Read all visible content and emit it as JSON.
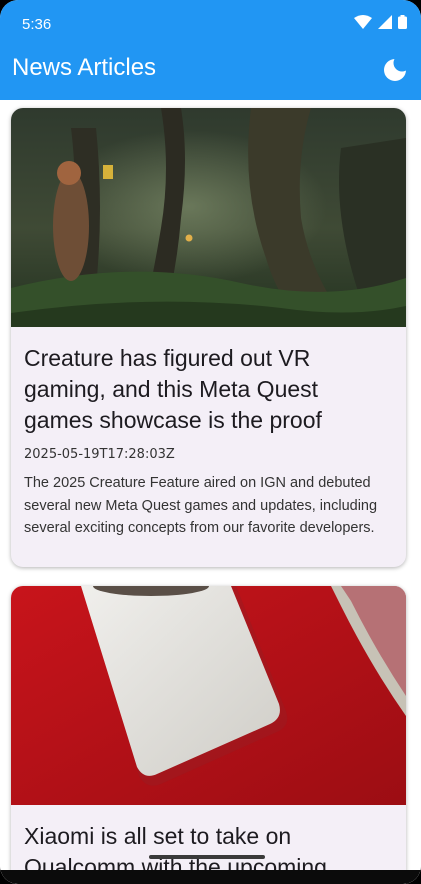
{
  "status_bar": {
    "time": "5:36"
  },
  "app_bar": {
    "title": "News Articles",
    "theme_icon": "moon-icon"
  },
  "colors": {
    "primary": "#2196F3",
    "card_background": "#f4eff7"
  },
  "articles": [
    {
      "title": "Creature has figured out VR gaming, and this Meta Quest games showcase is the proof",
      "date": "2025-05-19T17:28:03Z",
      "description": "The 2025 Creature Feature aired on IGN and debuted several new Meta Quest games and updates, including several exciting concepts from our favorite developers."
    },
    {
      "title": "Xiaomi is all set to take on Qualcomm with the upcoming"
    }
  ]
}
